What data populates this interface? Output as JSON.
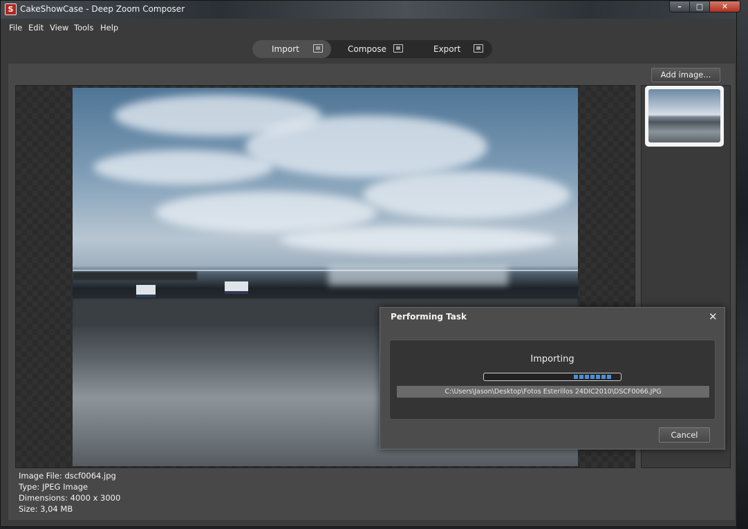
{
  "window": {
    "title": "CakeShowCase - Deep Zoom Composer",
    "minimize": "–",
    "maximize": "□",
    "close": "✕"
  },
  "menu": [
    "File",
    "Edit",
    "View",
    "Tools",
    "Help"
  ],
  "modes": {
    "import": "Import",
    "compose": "Compose",
    "export": "Export",
    "active": "Import"
  },
  "sidebar": {
    "add_image": "Add image..."
  },
  "image_info": {
    "file": "Image File: dscf0064.jpg",
    "type": "Type: JPEG Image",
    "dimensions": "Dimensions: 4000 x 3000",
    "size": "Size: 3,04 MB"
  },
  "dialog": {
    "title": "Performing Task",
    "close": "✕",
    "task": "Importing",
    "file_path": "C:\\Users\\Jason\\Desktop\\Fotos Esterillos 24DIC2010\\DSCF0066.JPG",
    "cancel": "Cancel",
    "progress": 0.3
  },
  "colors": {
    "window_bg": "#3b3b3b",
    "content_bg": "#484848",
    "progress_accent": "#4a90d9"
  }
}
